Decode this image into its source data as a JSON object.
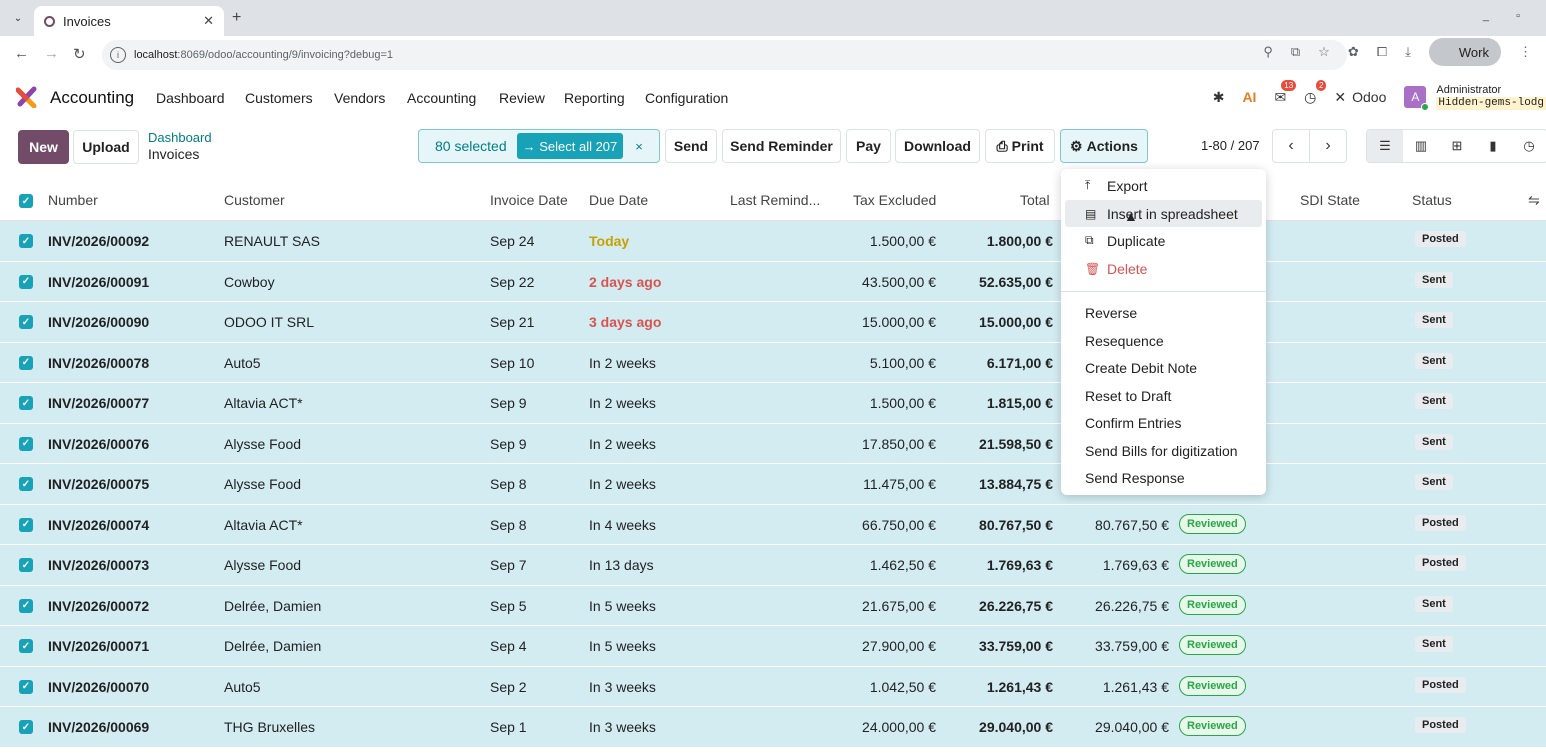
{
  "browser": {
    "tab_title": "Invoices",
    "url_host": "localhost",
    "url_path": ":8069/odoo/accounting/9/invoicing?debug=1",
    "profile": "Work"
  },
  "menu": {
    "app": "Accounting",
    "items": [
      "Dashboard",
      "Customers",
      "Vendors",
      "Accounting",
      "Review",
      "Reporting",
      "Configuration"
    ],
    "msg_badge": "13",
    "act_badge": "2",
    "company": "Odoo",
    "avatar": "A",
    "user": "Administrator",
    "db": "Hidden-gems-lodg"
  },
  "cp": {
    "new": "New",
    "upload": "Upload",
    "bc_parent": "Dashboard",
    "bc_current": "Invoices",
    "selected": "80 selected",
    "select_all": "→ Select all 207",
    "clear": "×",
    "send": "Send",
    "send_reminder": "Send Reminder",
    "pay": "Pay",
    "download": "Download",
    "print": "Print",
    "actions": "Actions",
    "pager": "1-80 / 207"
  },
  "columns": {
    "number": "Number",
    "customer": "Customer",
    "invoice_date": "Invoice Date",
    "due_date": "Due Date",
    "last_reminder": "Last Remind...",
    "tax_excluded": "Tax Excluded",
    "total": "Total",
    "sdi_state": "SDI State",
    "status": "Status"
  },
  "rows": [
    {
      "number": "INV/2026/00092",
      "customer": "RENAULT SAS",
      "date": "Sep 24",
      "due": "Today",
      "due_style": "today",
      "tax": "1.500,00 €",
      "total": "1.800,00 €",
      "amount": "",
      "review": "",
      "status": "Posted"
    },
    {
      "number": "INV/2026/00091",
      "customer": "Cowboy",
      "date": "Sep 22",
      "due": "2 days ago",
      "due_style": "late",
      "tax": "43.500,00 €",
      "total": "52.635,00 €",
      "amount": "",
      "review": "",
      "status": "Sent"
    },
    {
      "number": "INV/2026/00090",
      "customer": "ODOO IT SRL",
      "date": "Sep 21",
      "due": "3 days ago",
      "due_style": "late",
      "tax": "15.000,00 €",
      "total": "15.000,00 €",
      "amount": "",
      "review": "",
      "status": "Sent"
    },
    {
      "number": "INV/2026/00078",
      "customer": "Auto5",
      "date": "Sep 10",
      "due": "In 2 weeks",
      "due_style": "",
      "tax": "5.100,00 €",
      "total": "6.171,00 €",
      "amount": "",
      "review": "",
      "status": "Sent"
    },
    {
      "number": "INV/2026/00077",
      "customer": "Altavia ACT*",
      "date": "Sep 9",
      "due": "In 2 weeks",
      "due_style": "",
      "tax": "1.500,00 €",
      "total": "1.815,00 €",
      "amount": "",
      "review": "",
      "status": "Sent"
    },
    {
      "number": "INV/2026/00076",
      "customer": "Alysse Food",
      "date": "Sep 9",
      "due": "In 2 weeks",
      "due_style": "",
      "tax": "17.850,00 €",
      "total": "21.598,50 €",
      "amount": "",
      "review": "",
      "status": "Sent"
    },
    {
      "number": "INV/2026/00075",
      "customer": "Alysse Food",
      "date": "Sep 8",
      "due": "In 2 weeks",
      "due_style": "",
      "tax": "11.475,00 €",
      "total": "13.884,75 €",
      "amount": "",
      "review": "",
      "status": "Sent"
    },
    {
      "number": "INV/2026/00074",
      "customer": "Altavia ACT*",
      "date": "Sep 8",
      "due": "In 4 weeks",
      "due_style": "",
      "tax": "66.750,00 €",
      "total": "80.767,50 €",
      "amount": "80.767,50 €",
      "review": "Reviewed",
      "status": "Posted"
    },
    {
      "number": "INV/2026/00073",
      "customer": "Alysse Food",
      "date": "Sep 7",
      "due": "In 13 days",
      "due_style": "",
      "tax": "1.462,50 €",
      "total": "1.769,63 €",
      "amount": "1.769,63 €",
      "review": "Reviewed",
      "status": "Posted"
    },
    {
      "number": "INV/2026/00072",
      "customer": "Delrée, Damien",
      "date": "Sep 5",
      "due": "In 5 weeks",
      "due_style": "",
      "tax": "21.675,00 €",
      "total": "26.226,75 €",
      "amount": "26.226,75 €",
      "review": "Reviewed",
      "status": "Sent"
    },
    {
      "number": "INV/2026/00071",
      "customer": "Delrée, Damien",
      "date": "Sep 4",
      "due": "In 5 weeks",
      "due_style": "",
      "tax": "27.900,00 €",
      "total": "33.759,00 €",
      "amount": "33.759,00 €",
      "review": "Reviewed",
      "status": "Sent"
    },
    {
      "number": "INV/2026/00070",
      "customer": "Auto5",
      "date": "Sep 2",
      "due": "In 3 weeks",
      "due_style": "",
      "tax": "1.042,50 €",
      "total": "1.261,43 €",
      "amount": "1.261,43 €",
      "review": "Reviewed",
      "status": "Posted"
    },
    {
      "number": "INV/2026/00069",
      "customer": "THG Bruxelles",
      "date": "Sep 1",
      "due": "In 3 weeks",
      "due_style": "",
      "tax": "24.000,00 €",
      "total": "29.040,00 €",
      "amount": "29.040,00 €",
      "review": "Reviewed",
      "status": "Posted"
    }
  ],
  "actions_menu": {
    "export": "Export",
    "insert": "Insert in spreadsheet",
    "duplicate": "Duplicate",
    "delete": "Delete",
    "reverse": "Reverse",
    "resequence": "Resequence",
    "debit_note": "Create Debit Note",
    "reset_draft": "Reset to Draft",
    "confirm": "Confirm Entries",
    "send_bills": "Send Bills for digitization",
    "send_response": "Send Response"
  }
}
